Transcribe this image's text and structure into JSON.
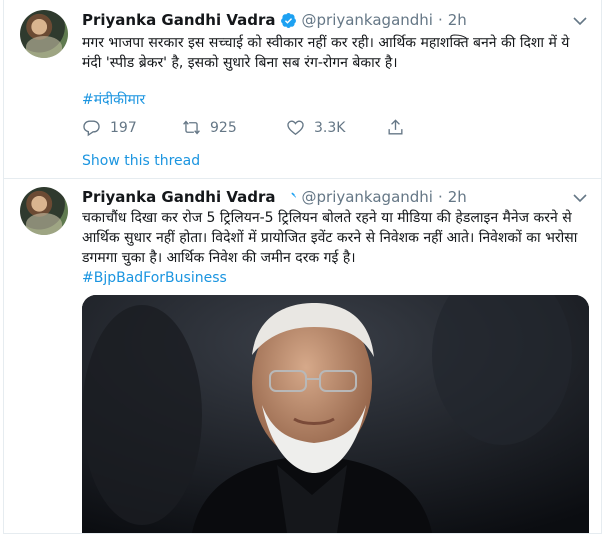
{
  "tweets": [
    {
      "author": "Priyanka Gandhi Vadra",
      "handle": "@priyankagandhi",
      "separator": "·",
      "time": "2h",
      "text": "मगर भाजपा सरकार इस सच्चाई को स्वीकार नहीं कर रही। आर्थिक महाशक्ति बनने की दिशा में ये मंदी 'स्पीड ब्रेकर' है, इसको सुधारे बिना सब रंग-रोगन बेकार है।",
      "hashtag": "#मंदीकीमार",
      "replies": "197",
      "retweets": "925",
      "likes": "3.3K",
      "show_thread": "Show this thread"
    },
    {
      "author": "Priyanka Gandhi Vadra",
      "handle": "@priyankagandhi",
      "separator": "·",
      "time": "2h",
      "text": "चकाचौंध दिखा कर रोज 5 ट्रिलियन-5 ट्रिलियन बोलते रहने या मीडिया की हेडलाइन मैनेज करने से आर्थिक सुधार नहीं होता। विदेशों में प्रायोजित इवेंट करने से निवेशक नहीं आते। निवेशकों का भरोसा डगमगा चुका है। आर्थिक निवेश की जमीन दरक गई है।",
      "hashtag": "#BjpBadForBusiness"
    }
  ],
  "icons": {
    "verified": "verified-badge-icon",
    "caret": "chevron-down-icon",
    "reply": "reply-icon",
    "retweet": "retweet-icon",
    "like": "heart-icon",
    "share": "share-icon"
  },
  "colors": {
    "link": "#1b95e0",
    "muted": "#657786",
    "verified": "#1da1f2",
    "divider": "#e6ecf0"
  }
}
